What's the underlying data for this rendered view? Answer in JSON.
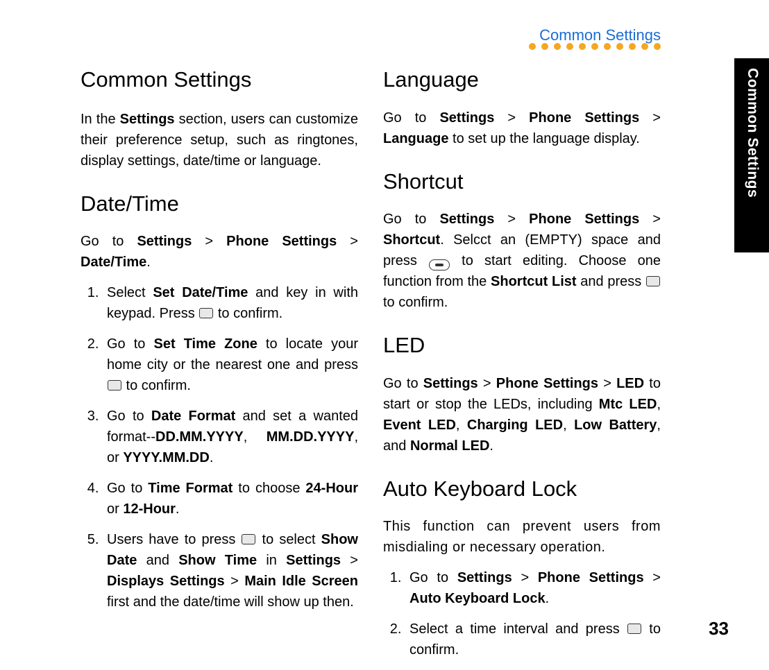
{
  "header": {
    "section_title": "Common Settings",
    "side_tab": "Common Settings",
    "page_number": "33"
  },
  "left": {
    "h1": "Common Settings",
    "intro_a": "In the ",
    "intro_b": "Settings",
    "intro_c": " section, users can customize their preference setup, such as ringtones, display settings, date/time or language.",
    "h2_dt": "Date/Time",
    "dt_intro_a": "Go to ",
    "dt_intro_b": "Settings",
    "dt_intro_c": " > ",
    "dt_intro_d": "Phone Settings",
    "dt_intro_e": " > ",
    "dt_intro_f": "Date/Time",
    "dt_intro_g": ".",
    "li1_a": "Select ",
    "li1_b": "Set Date/Time",
    "li1_c": " and key in with keypad. Press ",
    "li1_d": " to confirm.",
    "li2_a": "Go to ",
    "li2_b": "Set Time Zone",
    "li2_c": " to locate your home city or the nearest one and press ",
    "li2_d": " to confirm.",
    "li3_a": "Go to ",
    "li3_b": "Date Format",
    "li3_c": " and set a wanted format--",
    "li3_d": "DD.MM.YYYY",
    "li3_e": ", ",
    "li3_f": "MM.DD.YYYY",
    "li3_g": ", or ",
    "li3_h": "YYYY.MM.DD",
    "li3_i": ".",
    "li4_a": "Go to ",
    "li4_b": "Time Format",
    "li4_c": " to choose ",
    "li4_d": "24-Hour",
    "li4_e": " or ",
    "li4_f": "12-Hour",
    "li4_g": ".",
    "li5_a": "Users have to press ",
    "li5_b": " to select ",
    "li5_c": "Show Date",
    "li5_d": " and ",
    "li5_e": "Show Time",
    "li5_f": " in ",
    "li5_g": "Settings",
    "li5_h": " > ",
    "li5_i": "Displays Settings",
    "li5_j": " > ",
    "li5_k": "Main Idle Screen",
    "li5_l": " first and the date/time will show up then."
  },
  "right": {
    "h2_lang": "Language",
    "lang_a": "Go to ",
    "lang_b": "Settings",
    "lang_c": " > ",
    "lang_d": "Phone Settings",
    "lang_e": " > ",
    "lang_f": "Language",
    "lang_g": " to set up the language display.",
    "h2_sc": "Shortcut",
    "sc_a": "Go to ",
    "sc_b": "Settings",
    "sc_c": " > ",
    "sc_d": "Phone Settings",
    "sc_e": " > ",
    "sc_f": "Shortcut",
    "sc_g": ". Selcct an (EMPTY) space and press ",
    "sc_h": " to start editing. Choose one function from the ",
    "sc_i": "Shortcut List",
    "sc_j": " and press ",
    "sc_k": " to confirm.",
    "h2_led": "LED",
    "led_a": "Go to ",
    "led_b": "Settings",
    "led_c": " > ",
    "led_d": "Phone Settings",
    "led_e": " > ",
    "led_f": "LED",
    "led_g": " to start or stop the LEDs, including ",
    "led_h": "Mtc LED",
    "led_i": ", ",
    "led_j": "Event LED",
    "led_k": ", ",
    "led_l": "Charging LED",
    "led_m": ", ",
    "led_n": "Low Battery",
    "led_o": ", and ",
    "led_p": "Normal LED",
    "led_q": ".",
    "h2_akl": "Auto Keyboard Lock",
    "akl_intro": "This function can prevent users from misdialing or necessary operation.",
    "akl1_a": "Go to ",
    "akl1_b": "Settings",
    "akl1_c": " > ",
    "akl1_d": "Phone Settings",
    "akl1_e": " > ",
    "akl1_f": "Auto Keyboard Lock",
    "akl1_g": ".",
    "akl2_a": "Select a time interval and press ",
    "akl2_b": " to confirm."
  }
}
